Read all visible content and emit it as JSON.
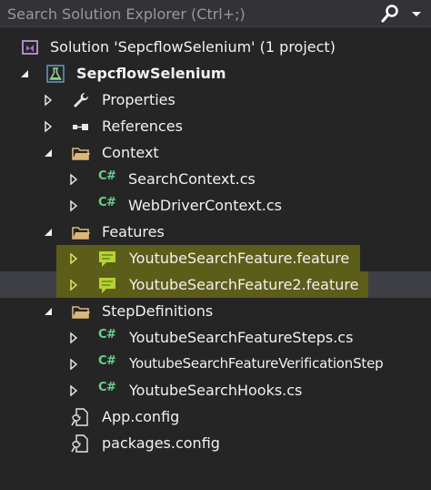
{
  "search": {
    "placeholder": "Search Solution Explorer (Ctrl+;)"
  },
  "tree": {
    "solution": "Solution 'SepcflowSelenium' (1 project)",
    "project": "SepcflowSelenium",
    "properties": "Properties",
    "references": "References",
    "context_folder": "Context",
    "search_context": "SearchContext.cs",
    "webdriver_context": "WebDriverContext.cs",
    "features_folder": "Features",
    "feature1": "YoutubeSearchFeature.feature",
    "feature2": "YoutubeSearchFeature2.feature",
    "stepdefs_folder": "StepDefinitions",
    "steps1": "YoutubeSearchFeatureSteps.cs",
    "steps2": "YoutubeSearchFeatureVerificationStep",
    "hooks": "YoutubeSearchHooks.cs",
    "app_config": "App.config",
    "packages_config": "packages.config"
  },
  "icons": {
    "cs_text": "C#"
  },
  "colors": {
    "background": "#252526",
    "selection": "#3f3f46",
    "highlight": "#5d5d1a",
    "folder": "#dcb67a",
    "csharp": "#6bd08a",
    "feature": "#b4d334"
  }
}
